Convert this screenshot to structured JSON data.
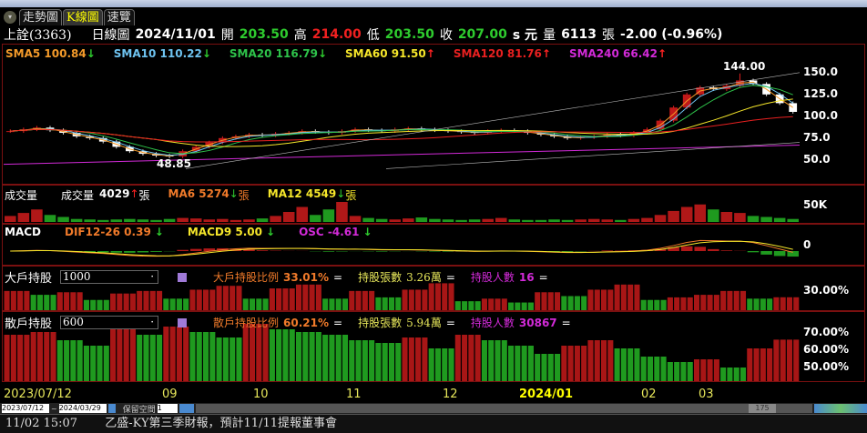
{
  "tabs": [
    "走勢圖",
    "K線圖",
    "速覽"
  ],
  "header": {
    "stock": "上詮(3363)",
    "period": "日線圖",
    "date": "2024/11/01",
    "open_label": "開",
    "open": "203.50",
    "high_label": "高",
    "high": "214.00",
    "low_label": "低",
    "low": "203.50",
    "close_label": "收",
    "close": "207.00",
    "unit": "s 元",
    "vol_label": "量",
    "volume": "6113",
    "vol_unit": "張",
    "change": "-2.00 (-0.96%)"
  },
  "sma": [
    {
      "label": "SMA5 100.84",
      "arrow": "↓",
      "color": "#f39a2a"
    },
    {
      "label": "SMA10 110.22",
      "arrow": "↓",
      "color": "#6ec3f0"
    },
    {
      "label": "SMA20 116.79",
      "arrow": "↓",
      "color": "#2ec34a"
    },
    {
      "label": "SMA60 91.50",
      "arrow": "↑",
      "color": "#f5e62a"
    },
    {
      "label": "SMA120 81.76",
      "arrow": "↑",
      "color": "#e82020"
    },
    {
      "label": "SMA240 66.42",
      "arrow": "↑",
      "color": "#d22ad8"
    }
  ],
  "price_axis": [
    "150.0",
    "125.0",
    "100.0",
    "75.0",
    "50.0"
  ],
  "high_mark": "144.00",
  "low_mark": "48.85",
  "volume": {
    "title": "成交量",
    "label": "成交量",
    "value": "4029",
    "arrow": "↑",
    "unit": "張",
    "ma6": "MA6 5274",
    "ma6_arrow": "↓",
    "ma12": "MA12 4549",
    "ma12_arrow": "↓",
    "axis": "50K"
  },
  "macd": {
    "title": "MACD",
    "dif": "DIF12-26 0.39",
    "dif_arrow": "↓",
    "macd9": "MACD9 5.00",
    "macd9_arrow": "↓",
    "osc": "OSC -4.61",
    "osc_arrow": "↓",
    "axis": "0"
  },
  "big_holders": {
    "title": "大戶持股",
    "threshold": "1000",
    "ratio_label": "大戶持股比例",
    "ratio": "33.01%",
    "eq": "=",
    "shares_label": "持股張數",
    "shares": "3.26萬",
    "people_label": "持股人數",
    "people": "16",
    "axis": "30.00%"
  },
  "retail_holders": {
    "title": "散戶持股",
    "threshold": "600",
    "ratio_label": "散戶持股比例",
    "ratio": "60.21%",
    "eq": "=",
    "shares_label": "持股張數",
    "shares": "5.94萬",
    "people_label": "持股人數",
    "people": "30867",
    "axis": [
      "70.00%",
      "60.00%",
      "50.00%"
    ]
  },
  "x_axis": [
    "2023/07/12",
    "09",
    "10",
    "11",
    "12",
    "2024/01",
    "02",
    "03"
  ],
  "range": {
    "from": "2023/07/12",
    "to": "2024/03/29",
    "reserve_label": "保留空間",
    "reserve": "1",
    "count": "175"
  },
  "news": {
    "time": "11/02 15:07",
    "text": "乙盛-KY第三季財報，預計11/11提報董事會"
  },
  "chart_data": {
    "type": "candlestick",
    "closes": [
      78,
      80,
      82,
      79,
      76,
      72,
      70,
      66,
      60,
      55,
      52,
      50,
      49,
      55,
      60,
      65,
      70,
      72,
      74,
      73,
      75,
      76,
      78,
      77,
      76,
      78,
      80,
      79,
      78,
      80,
      81,
      80,
      79,
      78,
      77,
      76,
      78,
      79,
      78,
      76,
      74,
      72,
      70,
      71,
      72,
      74,
      73,
      76,
      80,
      90,
      105,
      120,
      128,
      126,
      130,
      136,
      132,
      120,
      110,
      100
    ],
    "volumes": [
      12,
      18,
      25,
      14,
      10,
      6,
      5,
      4,
      5,
      6,
      5,
      4,
      6,
      8,
      7,
      5,
      6,
      4,
      5,
      7,
      12,
      20,
      30,
      14,
      25,
      40,
      12,
      8,
      6,
      5,
      7,
      9,
      6,
      5,
      4,
      5,
      6,
      8,
      5,
      4,
      4,
      5,
      4,
      5,
      6,
      5,
      4,
      6,
      8,
      14,
      22,
      30,
      35,
      25,
      20,
      18,
      12,
      10,
      8,
      6
    ],
    "big_ratio": [
      33.5,
      33.2,
      33.4,
      32.8,
      33.3,
      33.5,
      32.9,
      33.6,
      33.9,
      32.9,
      33.7,
      34.0,
      32.9,
      33.5,
      33.0,
      33.6,
      34.1,
      32.7,
      32.9,
      32.6,
      33.4,
      33.1,
      33.6,
      34.0,
      32.8,
      33.0,
      33.2,
      33.5,
      32.9,
      33.01
    ],
    "retail_ratio": [
      62,
      63,
      60,
      58,
      64,
      62,
      65,
      63,
      61,
      66,
      64,
      63,
      62,
      60,
      59,
      61,
      57,
      62,
      60,
      58,
      55,
      58,
      60,
      57,
      54,
      52,
      53,
      50,
      57,
      60.21
    ]
  }
}
